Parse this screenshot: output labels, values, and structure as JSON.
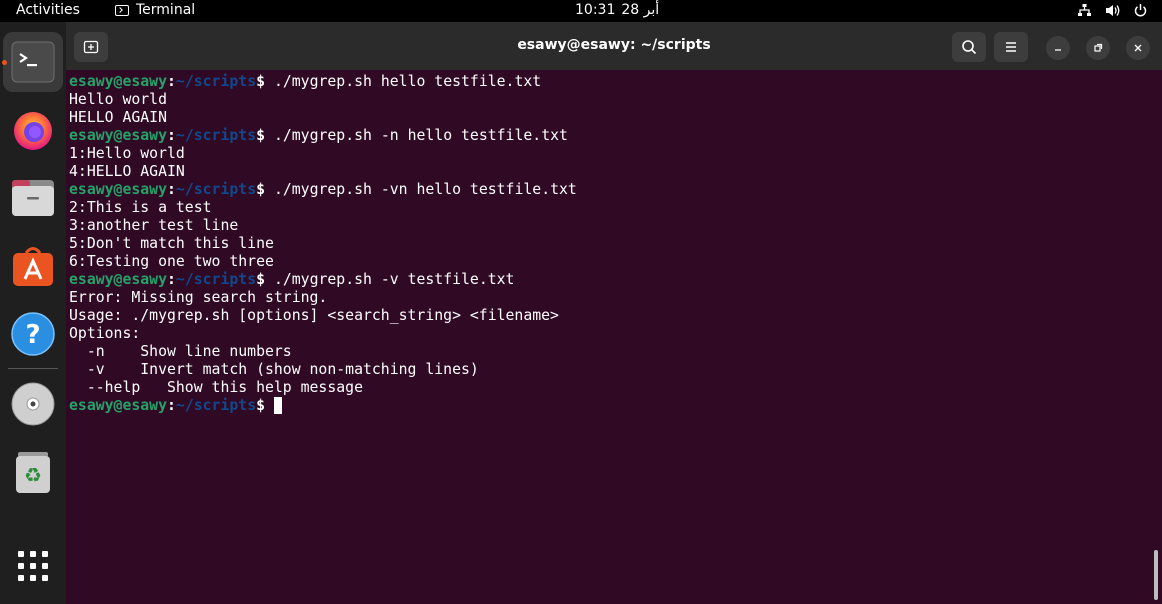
{
  "topbar": {
    "activities": "Activities",
    "app_name": "Terminal",
    "time": "10:31",
    "date": "28 أبر",
    "icons": [
      "network-icon",
      "volume-icon",
      "power-icon"
    ]
  },
  "dock": {
    "items": [
      "terminal",
      "firefox",
      "files",
      "app-center",
      "help",
      "dvd-drive",
      "trash",
      "show-apps"
    ]
  },
  "window": {
    "title": "esawy@esawy: ~/scripts"
  },
  "terminal": {
    "prompt": {
      "user": "esawy@esawy",
      "colon": ":",
      "path": "~/scripts",
      "symbol": "$"
    },
    "lines": [
      {
        "type": "prompt",
        "cmd": " ./mygrep.sh hello testfile.txt"
      },
      {
        "type": "out",
        "text": "Hello world"
      },
      {
        "type": "out",
        "text": "HELLO AGAIN"
      },
      {
        "type": "prompt",
        "cmd": " ./mygrep.sh -n hello testfile.txt"
      },
      {
        "type": "out",
        "text": "1:Hello world"
      },
      {
        "type": "out",
        "text": "4:HELLO AGAIN"
      },
      {
        "type": "prompt",
        "cmd": " ./mygrep.sh -vn hello testfile.txt"
      },
      {
        "type": "out",
        "text": "2:This is a test"
      },
      {
        "type": "out",
        "text": "3:another test line"
      },
      {
        "type": "out",
        "text": "5:Don't match this line"
      },
      {
        "type": "out",
        "text": "6:Testing one two three"
      },
      {
        "type": "prompt",
        "cmd": " ./mygrep.sh -v testfile.txt"
      },
      {
        "type": "out",
        "text": "Error: Missing search string."
      },
      {
        "type": "out",
        "text": "Usage: ./mygrep.sh [options] <search_string> <filename>"
      },
      {
        "type": "out",
        "text": "Options:"
      },
      {
        "type": "out",
        "text": "  -n    Show line numbers"
      },
      {
        "type": "out",
        "text": "  -v    Invert match (show non-matching lines)"
      },
      {
        "type": "out",
        "text": "  --help   Show this help message"
      },
      {
        "type": "prompt",
        "cmd": " ",
        "cursor": true
      }
    ]
  },
  "colors": {
    "terminal_bg": "#300a24",
    "user": "#26a269",
    "path": "#12488b",
    "accent": "#e95420"
  }
}
